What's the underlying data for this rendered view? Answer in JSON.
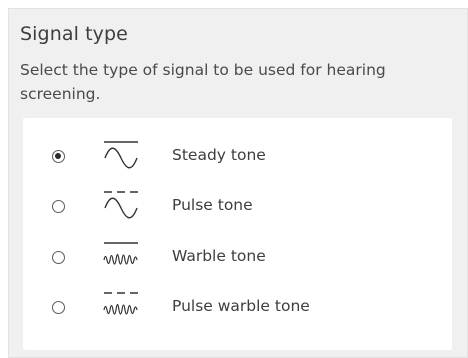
{
  "section": {
    "title": "Signal type",
    "description": "Select the type of signal to be used for hearing screening."
  },
  "options": [
    {
      "label": "Steady tone",
      "selected": true,
      "icon": "steady-tone-icon"
    },
    {
      "label": "Pulse tone",
      "selected": false,
      "icon": "pulse-tone-icon"
    },
    {
      "label": "Warble tone",
      "selected": false,
      "icon": "warble-tone-icon"
    },
    {
      "label": "Pulse warble tone",
      "selected": false,
      "icon": "pulse-warble-tone-icon"
    }
  ]
}
